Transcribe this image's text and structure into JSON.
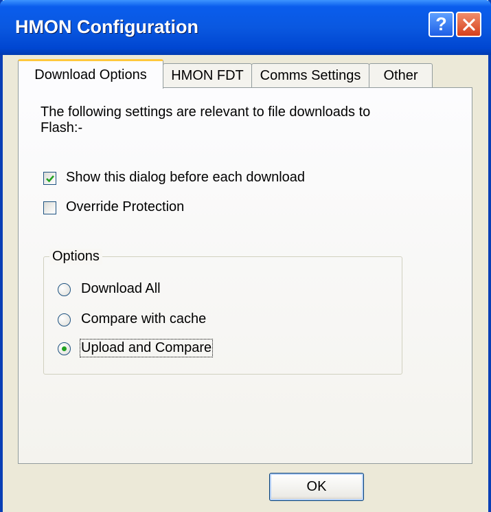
{
  "window": {
    "title": "HMON Configuration",
    "help_glyph": "?",
    "close_icon": "close-icon"
  },
  "tabs": [
    {
      "label": "Download Options",
      "active": true
    },
    {
      "label": "HMON FDT",
      "active": false
    },
    {
      "label": "Comms Settings",
      "active": false
    },
    {
      "label": "Other",
      "active": false
    }
  ],
  "content": {
    "description_line1": "The following settings are relevant to file downloads to",
    "description_line2": "Flash:-",
    "checkboxes": [
      {
        "label": "Show this dialog before each download",
        "checked": true
      },
      {
        "label": "Override Protection",
        "checked": false
      }
    ],
    "options_group": {
      "label": "Options",
      "radios": [
        {
          "label": "Download All",
          "selected": false
        },
        {
          "label": "Compare with cache",
          "selected": false
        },
        {
          "label": "Upload and Compare",
          "selected": true
        }
      ]
    }
  },
  "footer": {
    "ok_label": "OK"
  },
  "colors": {
    "titlebar": "#0a58e0",
    "dialog_bg": "#ece9d8",
    "active_tab_highlight": "#ffc83c",
    "radio_dot": "#21a121"
  }
}
